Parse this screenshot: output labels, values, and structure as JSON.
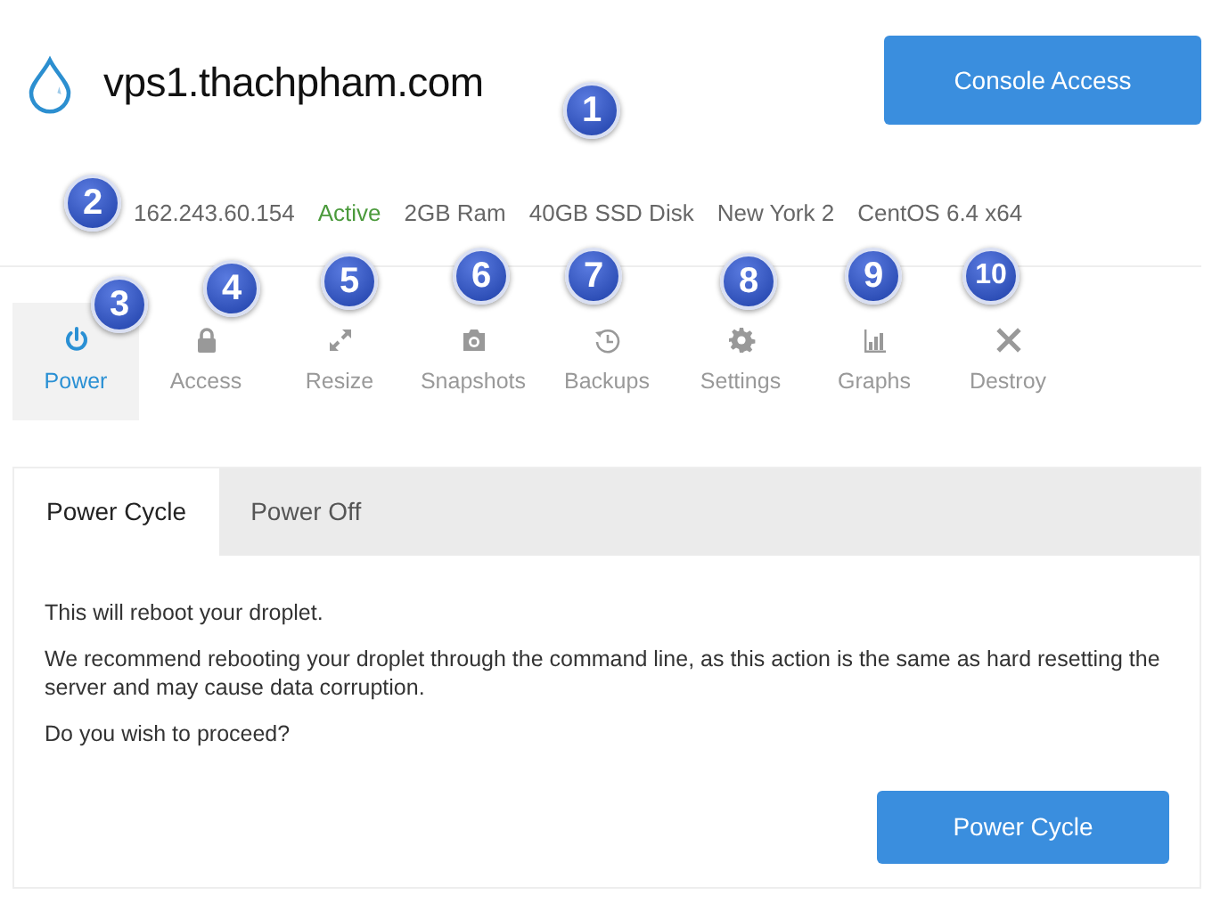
{
  "header": {
    "hostname": "vps1.thachpham.com",
    "hostname_callout": "1",
    "console_button": "Console Access"
  },
  "info": {
    "callout": "2",
    "items": [
      {
        "kind": "plain",
        "text": "162.243.60.154"
      },
      {
        "kind": "status",
        "text": "Active"
      },
      {
        "kind": "plain",
        "text": "2GB Ram"
      },
      {
        "kind": "plain",
        "text": "40GB SSD Disk"
      },
      {
        "kind": "plain",
        "text": "New York 2"
      },
      {
        "kind": "plain",
        "text": "CentOS 6.4 x64"
      }
    ]
  },
  "nav": [
    {
      "label": "Power",
      "selected": true,
      "callout": "3"
    },
    {
      "label": "Access",
      "selected": false,
      "callout": "4"
    },
    {
      "label": "Resize",
      "selected": false,
      "callout": "5"
    },
    {
      "label": "Snapshots",
      "selected": false,
      "callout": "6"
    },
    {
      "label": "Backups",
      "selected": false,
      "callout": "7"
    },
    {
      "label": "Settings",
      "selected": false,
      "callout": "8"
    },
    {
      "label": "Graphs",
      "selected": false,
      "callout": "9"
    },
    {
      "label": "Destroy",
      "selected": false,
      "callout": "10"
    }
  ],
  "panel": {
    "tabs": [
      {
        "label": "Power Cycle",
        "selected": true
      },
      {
        "label": "Power Off",
        "selected": false
      }
    ],
    "paragraphs": [
      "This will reboot your droplet.",
      "We recommend rebooting your droplet through the command line, as this action is the same as hard resetting the server and may cause data corruption.",
      "Do you wish to proceed?"
    ],
    "button": "Power Cycle"
  }
}
